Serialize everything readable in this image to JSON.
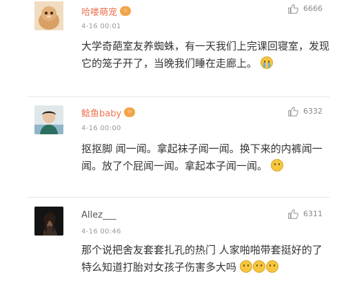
{
  "comments": [
    {
      "username": "哈喽萌宠",
      "time": "4-16 00:01",
      "likes": "6666",
      "text": "大学奇葩室友养蜘蛛，有一天我们上完课回寝室，发现它的笼子开了，当晚我们睡在走廊上。"
    },
    {
      "username": "鲶鱼baby",
      "time": "4-16 00:00",
      "likes": "6332",
      "text": "抠抠脚 闻一闻。拿起袜子闻一闻。换下来的内裤闻一闻。放了个屁闻一闻。拿起本子闻一闻。"
    },
    {
      "username": "Allez___",
      "time": "4-16 00:46",
      "likes": "6311",
      "text": "那个说把舍友套套扎孔的热门 人家啪啪带套挺好的了 特么知道打胎对女孩子伤害多大吗"
    }
  ],
  "icons": {
    "like": "thumbs-up-icon",
    "vip": "vip-badge-icon",
    "emoji": "emoji-face-icon"
  },
  "colors": {
    "username": "#eb7350",
    "divider": "#e6e6e6"
  }
}
